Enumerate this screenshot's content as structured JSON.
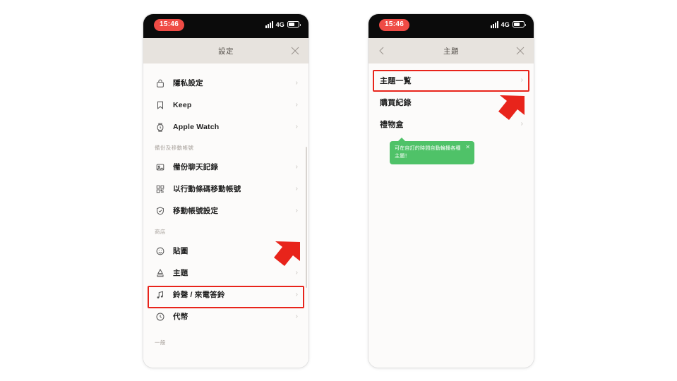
{
  "meta": {
    "background": "#ffffff",
    "highlight_color": "#e8241b",
    "tooltip_color": "#4fc268",
    "navbar_color": "#e7e3de"
  },
  "status_bar": {
    "time": "15:46",
    "network": "4G",
    "signal_icon": "signal-bars-icon",
    "battery_icon": "battery-icon"
  },
  "left_phone": {
    "nav": {
      "title": "設定",
      "close_icon": "close-icon"
    },
    "sections": [
      {
        "label": "",
        "items": [
          {
            "icon": "lock-icon",
            "label": "隱私設定",
            "chevron": "›"
          },
          {
            "icon": "bookmark-icon",
            "label": "Keep",
            "chevron": "›"
          },
          {
            "icon": "watch-icon",
            "label": "Apple Watch",
            "chevron": "›"
          }
        ]
      },
      {
        "label": "備份及移動帳號",
        "items": [
          {
            "icon": "backup-photo-icon",
            "label": "備份聊天記錄",
            "chevron": "›"
          },
          {
            "icon": "qr-code-icon",
            "label": "以行動條碼移動帳號",
            "chevron": "›"
          },
          {
            "icon": "shield-icon",
            "label": "移動帳號設定",
            "chevron": "›"
          }
        ]
      },
      {
        "label": "商店",
        "items": [
          {
            "icon": "sticker-smiley-icon",
            "label": "貼圖",
            "chevron": "›"
          },
          {
            "icon": "theme-palette-icon",
            "label": "主題",
            "chevron": "›"
          },
          {
            "icon": "music-note-icon",
            "label": "鈴聲 / 來電答鈴",
            "chevron": "›"
          },
          {
            "icon": "coin-icon",
            "label": "代幣",
            "chevron": "›"
          }
        ]
      },
      {
        "label": "一般",
        "items": []
      }
    ],
    "highlighted_item": "主題",
    "arrow_icon": "red-pointer-arrow-icon"
  },
  "right_phone": {
    "nav": {
      "back_icon": "chevron-left-icon",
      "title": "主題",
      "close_icon": "close-icon"
    },
    "items": [
      {
        "label": "主題一覧",
        "chevron": "›"
      },
      {
        "label": "購買紀錄",
        "chevron": "›"
      },
      {
        "label": "禮物盒",
        "chevron": "›"
      }
    ],
    "highlighted_item": "主題一覧",
    "tooltip": {
      "text": "可在自訂的時間自動輪播各種主題！",
      "close_icon": "close-icon"
    },
    "arrow_icon": "red-pointer-arrow-icon"
  }
}
